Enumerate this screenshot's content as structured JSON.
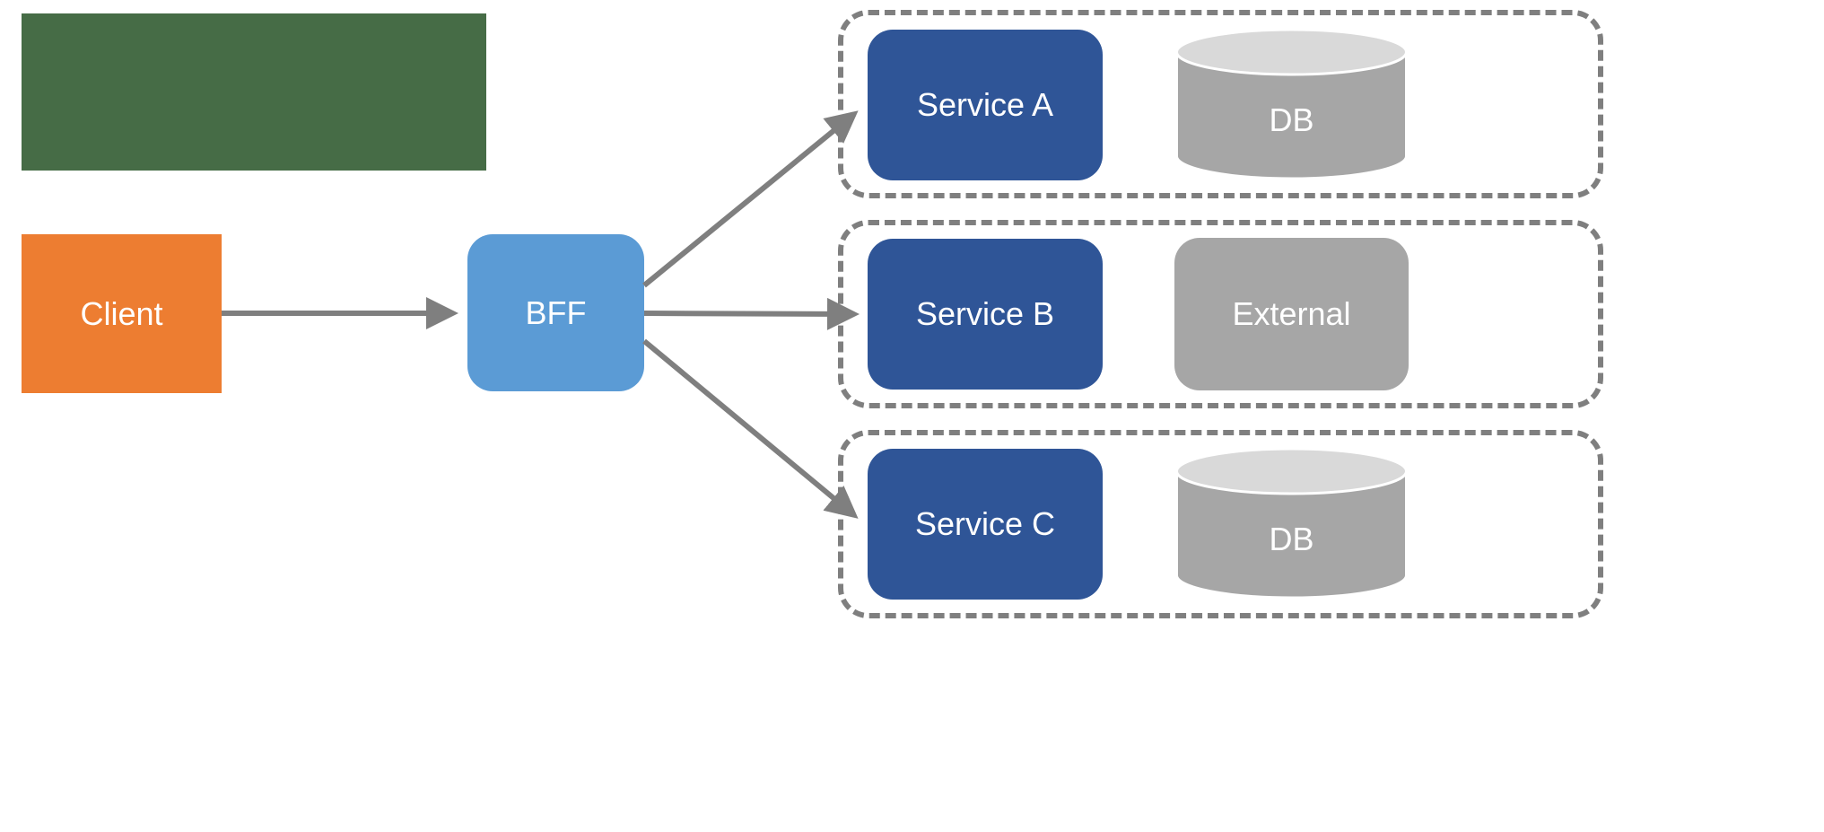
{
  "colors": {
    "green": "#466c46",
    "orange": "#ed7d31",
    "light_blue": "#5b9bd5",
    "blue": "#2f5597",
    "grey": "#a6a6a6",
    "grey_light": "#d9d9d9",
    "dash": "#7f7f7f",
    "arrow": "#7f7f7f"
  },
  "nodes": {
    "green_block": {
      "label": ""
    },
    "client": {
      "label": "Client"
    },
    "bff": {
      "label": "BFF"
    },
    "service_a": {
      "label": "Service A"
    },
    "service_b": {
      "label": "Service B"
    },
    "service_c": {
      "label": "Service C"
    },
    "db_a": {
      "label": "DB"
    },
    "external": {
      "label": "External"
    },
    "db_c": {
      "label": "DB"
    }
  },
  "arrows": [
    {
      "from": "client",
      "to": "bff"
    },
    {
      "from": "bff",
      "to": "service_a"
    },
    {
      "from": "bff",
      "to": "service_b"
    },
    {
      "from": "bff",
      "to": "service_c"
    }
  ]
}
